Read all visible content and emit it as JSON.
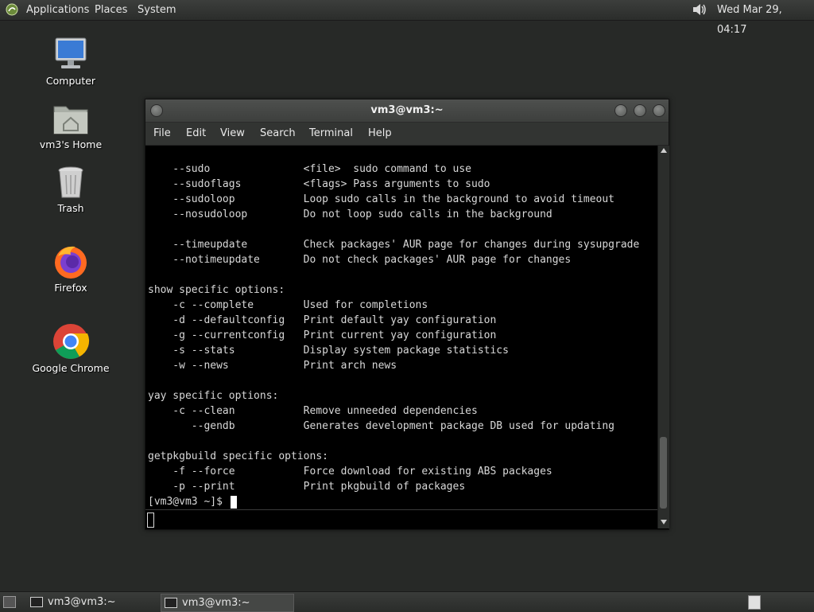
{
  "top_panel": {
    "menus": [
      "Applications",
      "Places",
      "System"
    ],
    "clock": "Wed Mar 29, 04:17",
    "icons": {
      "apps": "mate-logo-icon",
      "volume": "speaker-icon"
    }
  },
  "desktop_icons": [
    {
      "label": "Computer",
      "icon": "computer-icon"
    },
    {
      "label": "vm3's Home",
      "icon": "home-folder-icon"
    },
    {
      "label": "Trash",
      "icon": "trash-icon"
    },
    {
      "label": "Firefox",
      "icon": "firefox-icon"
    },
    {
      "label": "Google Chrome",
      "icon": "chrome-icon"
    }
  ],
  "terminal": {
    "title": "vm3@vm3:~",
    "menus": [
      "File",
      "Edit",
      "View",
      "Search",
      "Terminal",
      "Help"
    ],
    "lines": [
      "    --sudo               <file>  sudo command to use",
      "    --sudoflags          <flags> Pass arguments to sudo",
      "    --sudoloop           Loop sudo calls in the background to avoid timeout",
      "    --nosudoloop         Do not loop sudo calls in the background",
      "",
      "    --timeupdate         Check packages' AUR page for changes during sysupgrade",
      "    --notimeupdate       Do not check packages' AUR page for changes",
      "",
      "show specific options:",
      "    -c --complete        Used for completions",
      "    -d --defaultconfig   Print default yay configuration",
      "    -g --currentconfig   Print current yay configuration",
      "    -s --stats           Display system package statistics",
      "    -w --news            Print arch news",
      "",
      "yay specific options:",
      "    -c --clean           Remove unneeded dependencies",
      "       --gendb           Generates development package DB used for updating",
      "",
      "getpkgbuild specific options:",
      "    -f --force           Force download for existing ABS packages",
      "    -p --print           Print pkgbuild of packages",
      "[vm3@vm3 ~]$ "
    ]
  },
  "taskbar": {
    "items": [
      {
        "label": "vm3@vm3:~",
        "active": false
      },
      {
        "label": "vm3@vm3:~",
        "active": true
      }
    ]
  }
}
